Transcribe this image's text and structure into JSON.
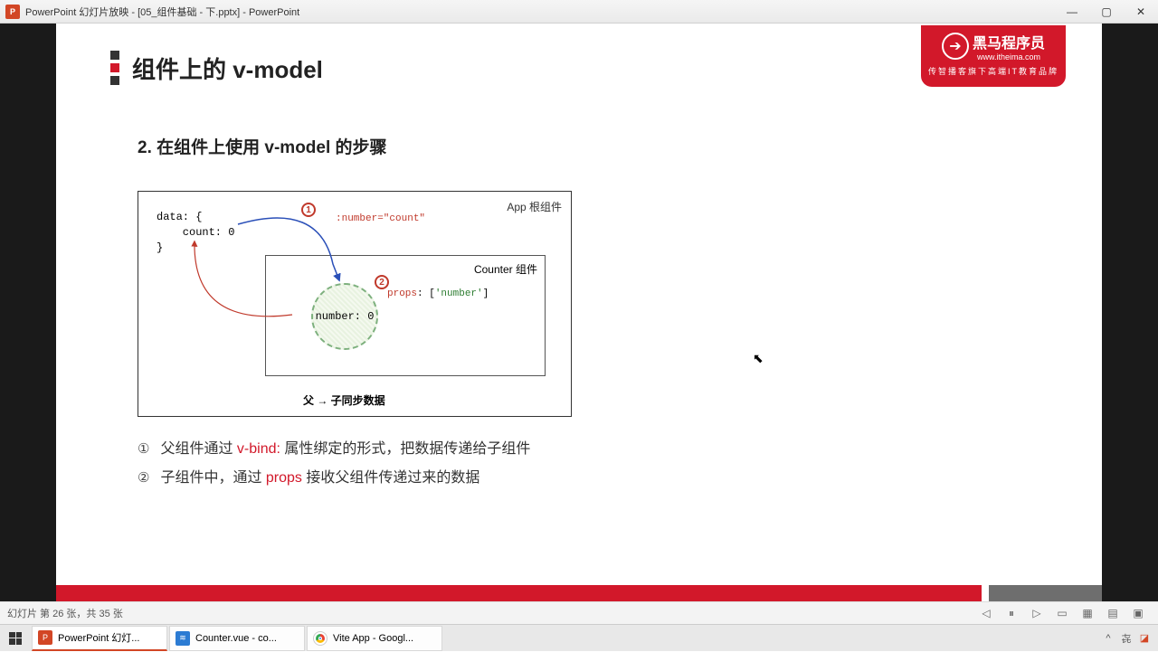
{
  "titlebar": {
    "app_icon_letter": "P",
    "title": "PowerPoint 幻灯片放映 - [05_组件基础 - 下.pptx] - PowerPoint"
  },
  "logo": {
    "main": "黑马程序员",
    "url": "www.itheima.com",
    "tagline": "传智播客旗下高端IT教育品牌"
  },
  "slide": {
    "heading": "组件上的 v-model",
    "subheading": "2. 在组件上使用 v-model 的步骤",
    "diagram": {
      "app_label": "App 根组件",
      "data_code": "data: {\n    count: 0\n}",
      "bind_code": ":number=\"count\"",
      "counter_label": "Counter 组件",
      "number_text": "number: 0",
      "props_kw": "props",
      "props_rest": ": [",
      "props_str": "'number'",
      "props_end": "]",
      "badge1": "1",
      "badge2": "2",
      "sync_label": "父 → 子同步数据"
    },
    "notes": {
      "n1_num": "①",
      "n1_a": "父组件通过 ",
      "n1_hl": "v-bind:",
      "n1_b": " 属性绑定的形式，把数据传递给子组件",
      "n2_num": "②",
      "n2_a": "子组件中，通过 ",
      "n2_hl": "props",
      "n2_b": " 接收父组件传递过来的数据"
    }
  },
  "statusbar": {
    "slide_counter": "幻灯片 第 26 张，共 35 张"
  },
  "taskbar": {
    "t1": "PowerPoint 幻灯...",
    "t2": "Counter.vue - co...",
    "t3": "Vite App - Googl...",
    "tray_up": "^"
  }
}
